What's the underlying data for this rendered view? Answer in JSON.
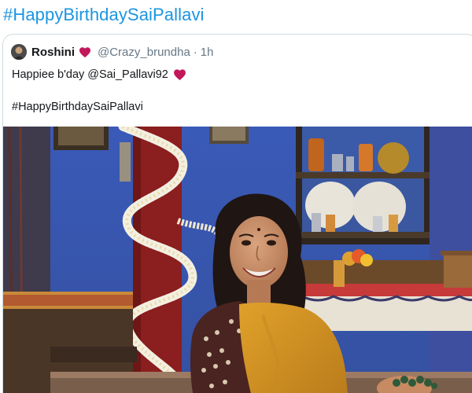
{
  "hashtag_title": "#HappyBirthdaySaiPallavi",
  "quoted_tweet": {
    "display_name": "Roshini",
    "handle": "@Crazy_brundha",
    "separator": "·",
    "timestamp": "1h",
    "text_line1": "Happiee b'day @Sai_Pallavi92",
    "text_line2": "#HappyBirthdaySaiPallavi",
    "heart_color": "#c2185b",
    "icons": [
      "avatar",
      "heart-icon",
      "heart-icon"
    ]
  },
  "colors": {
    "hashtag_blue": "#1b95e0",
    "card_border": "#cfd9de",
    "wall_blue": "#3b5bb5",
    "pillar_red": "#8b1e1e"
  }
}
